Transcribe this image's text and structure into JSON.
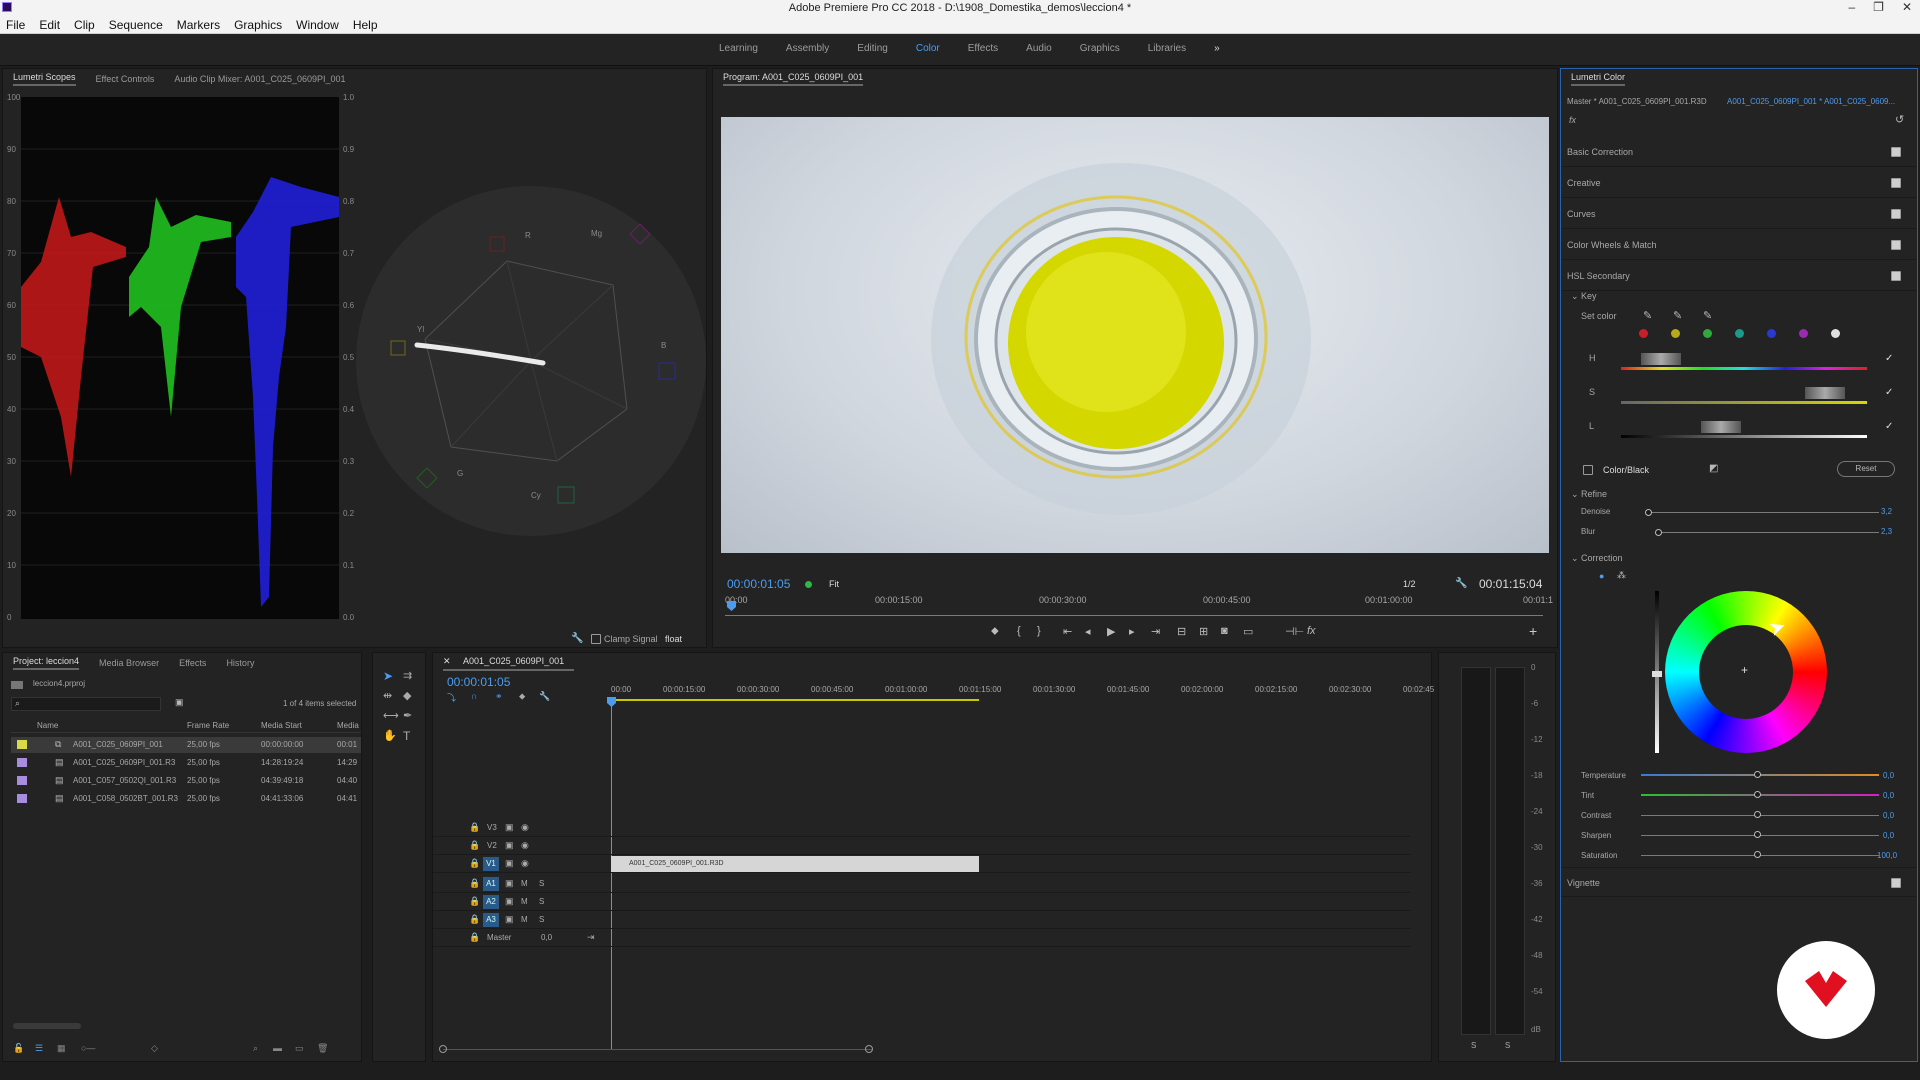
{
  "window": {
    "title": "Adobe Premiere Pro CC 2018 - D:\\1908_Domestika_demos\\leccion4 *",
    "controls": [
      "–",
      "❐",
      "✕"
    ]
  },
  "menu": [
    "File",
    "Edit",
    "Clip",
    "Sequence",
    "Markers",
    "Graphics",
    "Window",
    "Help"
  ],
  "workspaces": [
    "Learning",
    "Assembly",
    "Editing",
    "Color",
    "Effects",
    "Audio",
    "Graphics",
    "Libraries"
  ],
  "workspace_more": "»",
  "scopes": {
    "tabs": [
      "Lumetri Scopes",
      "Effect Controls",
      "Audio Clip Mixer: A001_C025_0609PI_001"
    ],
    "left_axis": [
      "100",
      "90",
      "80",
      "70",
      "60",
      "50",
      "40",
      "30",
      "20",
      "10",
      "0"
    ],
    "right_axis": [
      "1.0",
      "0.9",
      "0.8",
      "0.7",
      "0.6",
      "0.5",
      "0.4",
      "0.3",
      "0.2",
      "0.1",
      "0.0"
    ],
    "vector_labels": [
      "R",
      "Mg",
      "B",
      "Cy",
      "G",
      "Yl"
    ],
    "clamp": "Clamp Signal",
    "float": "float"
  },
  "program": {
    "tab": "Program: A001_C025_0609PI_001",
    "timecode": "00:00:01:05",
    "fit": "Fit",
    "quality": "1/2",
    "duration": "00:01:15:04",
    "ruler": [
      "00:00",
      "00:00:15:00",
      "00:00:30:00",
      "00:00:45:00",
      "00:01:00:00",
      "00:01:1"
    ]
  },
  "lumetri": {
    "tab": "Lumetri Color",
    "master": "Master * A001_C025_0609PI_001.R3D",
    "clip": "A001_C025_0609PI_001 * A001_C025_0609...",
    "fx": "fx",
    "sections": [
      "Basic Correction",
      "Creative",
      "Curves",
      "Color Wheels & Match",
      "HSL Secondary"
    ],
    "key": "Key",
    "set_color": "Set color",
    "hsl": [
      "H",
      "S",
      "L"
    ],
    "mode": "Color/Black",
    "reset": "Reset",
    "refine": "Refine",
    "denoise_label": "Denoise",
    "denoise": "3,2",
    "blur_label": "Blur",
    "blur": "2,3",
    "correction": "Correction",
    "sliders": [
      {
        "label": "Temperature",
        "value": "0,0"
      },
      {
        "label": "Tint",
        "value": "0,0"
      },
      {
        "label": "Contrast",
        "value": "0,0"
      },
      {
        "label": "Sharpen",
        "value": "0,0"
      },
      {
        "label": "Saturation",
        "value": "100,0"
      }
    ],
    "vignette": "Vignette",
    "swatches": [
      "#c8202a",
      "#b8a81a",
      "#2faa3a",
      "#1a9a8a",
      "#2a3ad0",
      "#9a2ab0",
      "#e0e0e0"
    ]
  },
  "project": {
    "tabs": [
      "Project: leccion4",
      "Media Browser",
      "Effects",
      "History"
    ],
    "file": "leccion4.prproj",
    "count": "1 of 4 items selected",
    "headers": [
      "Name",
      "Frame Rate",
      "Media Start",
      "Media"
    ],
    "rows": [
      {
        "name": "A001_C025_0609PI_001",
        "fps": "25,00 fps",
        "start": "00:00:00:00",
        "media": "00:01",
        "color": "#d8d84a"
      },
      {
        "name": "A001_C025_0609PI_001.R3",
        "fps": "25,00 fps",
        "start": "14:28:19:24",
        "media": "14:29",
        "color": "#a88ce0"
      },
      {
        "name": "A001_C057_0502QI_001.R3",
        "fps": "25,00 fps",
        "start": "04:39:49:18",
        "media": "04:40",
        "color": "#a88ce0"
      },
      {
        "name": "A001_C058_0502BT_001.R3",
        "fps": "25,00 fps",
        "start": "04:41:33:06",
        "media": "04:41",
        "color": "#a88ce0"
      }
    ]
  },
  "timeline": {
    "tab": "A001_C025_0609PI_001",
    "timecode": "00:00:01:05",
    "ruler": [
      "00:00",
      "00:00:15:00",
      "00:00:30:00",
      "00:00:45:00",
      "00:01:00:00",
      "00:01:15:00",
      "00:01:30:00",
      "00:01:45:00",
      "00:02:00:00",
      "00:02:15:00",
      "00:02:30:00",
      "00:02:45"
    ],
    "video_tracks": [
      "V3",
      "V2",
      "V1"
    ],
    "audio_tracks": [
      "A1",
      "A2",
      "A3"
    ],
    "master": "Master",
    "master_val": "0,0",
    "clip": "A001_C025_0609PI_001.R3D",
    "m": "M",
    "s": "S"
  },
  "meter": {
    "scale": [
      "0",
      "-6",
      "-12",
      "-18",
      "-24",
      "-30",
      "-36",
      "-42",
      "-48",
      "-54",
      "dB"
    ],
    "ss": [
      "S",
      "S"
    ]
  }
}
